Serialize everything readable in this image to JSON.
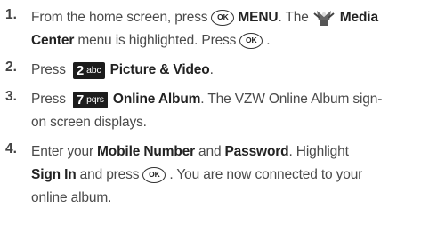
{
  "steps": [
    {
      "number": "1.",
      "line1": {
        "a": "From the home screen, press",
        "ok_label": "OK",
        "b": "MENU",
        "c": ". The",
        "d": "Media"
      },
      "line2": {
        "a": "Center",
        "b": " menu is highlighted. Press",
        "ok_label": "OK",
        "c": "."
      },
      "icon": "media-center-icon"
    },
    {
      "number": "2.",
      "line1": {
        "a": "Press",
        "key_digit": "2",
        "key_letters": "abc",
        "b": "Picture & Video",
        "c": "."
      }
    },
    {
      "number": "3.",
      "line1": {
        "a": "Press",
        "key_digit": "7",
        "key_letters": "pqrs",
        "b": "Online Album",
        "c": ". The VZW Online Album sign-"
      },
      "line2": {
        "a": "on screen displays."
      }
    },
    {
      "number": "4.",
      "line1": {
        "a": "Enter your",
        "b": "Mobile Number",
        "c": "and",
        "d": "Password",
        "e": ". Highlight"
      },
      "line2": {
        "a": "Sign In",
        "b": "and press",
        "ok_label": "OK",
        "c": ". You are now connected to your"
      },
      "line3": {
        "a": "online album."
      }
    }
  ]
}
